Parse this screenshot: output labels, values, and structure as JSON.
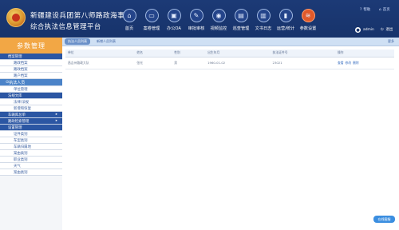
{
  "header": {
    "title_line1": "新疆建设兵团第八师路政海事局",
    "title_line2": "综合执法信息管理平台",
    "nav": [
      {
        "label": "首页",
        "icon": "home-icon",
        "glyph": "⌂"
      },
      {
        "label": "案卷管理",
        "icon": "folder-icon",
        "glyph": "▭"
      },
      {
        "label": "办公OA",
        "icon": "computer-icon",
        "glyph": "▣"
      },
      {
        "label": "审批审核",
        "icon": "edit-icon",
        "glyph": "✎"
      },
      {
        "label": "视频监控",
        "icon": "camera-icon",
        "glyph": "◉"
      },
      {
        "label": "巡查管理",
        "icon": "clipboard-icon",
        "glyph": "▤"
      },
      {
        "label": "文书日志",
        "icon": "book-icon",
        "glyph": "▥"
      },
      {
        "label": "运营/统计",
        "icon": "chart-icon",
        "glyph": "▮"
      },
      {
        "label": "参数设置",
        "icon": "settings-icon",
        "glyph": "≋"
      }
    ],
    "help_label": "帮助",
    "home_label": "首页",
    "username": "admin",
    "logout_label": "退出"
  },
  "sidebar": {
    "title": "参数管理",
    "items": [
      {
        "type": "group",
        "label": "档案管理",
        "arrow": ""
      },
      {
        "type": "sub",
        "label": "路政档案"
      },
      {
        "type": "sub",
        "label": "路政档案"
      },
      {
        "type": "sub",
        "label": "路户档案"
      },
      {
        "type": "active",
        "label": "执法人员"
      },
      {
        "type": "sub",
        "label": "单位管理"
      },
      {
        "type": "group",
        "label": "法规文库",
        "arrow": ""
      },
      {
        "type": "sub",
        "label": "法律/法规"
      },
      {
        "type": "sub",
        "label": "新增和恢复"
      },
      {
        "type": "group",
        "label": "车辆库总单",
        "arrow": "▸"
      },
      {
        "type": "group",
        "label": "路政检索管理",
        "arrow": "▸"
      },
      {
        "type": "group",
        "label": "设置管理",
        "arrow": ""
      },
      {
        "type": "sub",
        "label": "证件类别"
      },
      {
        "type": "sub",
        "label": "车型类别"
      },
      {
        "type": "sub",
        "label": "车辆归属地"
      },
      {
        "type": "sub",
        "label": "案由类别"
      },
      {
        "type": "sub",
        "label": "职业类别"
      },
      {
        "type": "sub",
        "label": "天气"
      },
      {
        "type": "sub",
        "label": "案由类别"
      }
    ]
  },
  "tabs": {
    "items": [
      "执法人员列表",
      "新增人员列表"
    ],
    "more": "更多"
  },
  "table": {
    "headers": [
      "单位",
      "姓名",
      "性别",
      "出生年月",
      "执法证件号",
      "操作"
    ],
    "rows": [
      {
        "cells": [
          "昌吉州路政大队",
          "张光",
          "男",
          "1960-01-02",
          "23021"
        ],
        "ops": [
          "查看",
          "修改",
          "删除"
        ]
      }
    ]
  },
  "online_service": "在线客服"
}
